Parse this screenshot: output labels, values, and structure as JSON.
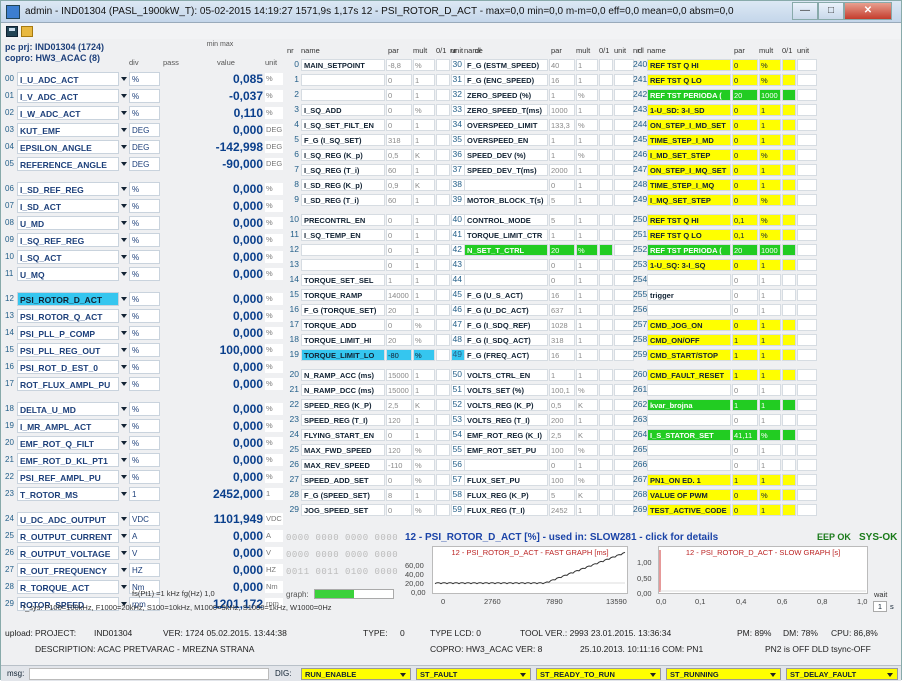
{
  "window": {
    "title": "admin - IND01304 (PASL_1900kW_T): 05-02-2015 14:19:27 1571,9s 1,17s 12 - PSI_ROTOR_D_ACT - max=0,0 min=0,0 m-m=0,0 eff=0,0 mean=0,0 absm=0,0",
    "min_glyph": "—",
    "max_glyph": "□",
    "close_glyph": "✕"
  },
  "left": {
    "header": {
      "pc_prj": "pc prj: IND01304 (1724)",
      "copro": "copro: HW3_ACAC (8)",
      "div": "div",
      "pass": "pass",
      "minmax": "min max",
      "value": "value",
      "unit": "unit"
    },
    "rows": [
      {
        "i": "00",
        "name": "I_U_ADC_ACT",
        "unit": "%",
        "value": "0,085",
        "vunit": "%"
      },
      {
        "i": "01",
        "name": "I_V_ADC_ACT",
        "unit": "%",
        "value": "-0,037",
        "vunit": "%"
      },
      {
        "i": "02",
        "name": "I_W_ADC_ACT",
        "unit": "%",
        "value": "0,110",
        "vunit": "%"
      },
      {
        "i": "03",
        "name": "KUT_EMF",
        "unit": "DEG",
        "value": "0,000",
        "vunit": "DEG"
      },
      {
        "i": "04",
        "name": "EPSILON_ANGLE",
        "unit": "DEG",
        "value": "-142,998",
        "vunit": "DEG"
      },
      {
        "i": "05",
        "name": "REFERENCE_ANGLE",
        "unit": "DEG",
        "value": "-90,000",
        "vunit": "DEG"
      },
      {
        "i": "06",
        "name": "I_SD_REF_REG",
        "unit": "%",
        "value": "0,000",
        "vunit": "%"
      },
      {
        "i": "07",
        "name": "I_SD_ACT",
        "unit": "%",
        "value": "0,000",
        "vunit": "%"
      },
      {
        "i": "08",
        "name": "U_MD",
        "unit": "%",
        "value": "0,000",
        "vunit": "%"
      },
      {
        "i": "09",
        "name": "I_SQ_REF_REG",
        "unit": "%",
        "value": "0,000",
        "vunit": "%"
      },
      {
        "i": "10",
        "name": "I_SQ_ACT",
        "unit": "%",
        "value": "0,000",
        "vunit": "%"
      },
      {
        "i": "11",
        "name": "U_MQ",
        "unit": "%",
        "value": "0,000",
        "vunit": "%"
      },
      {
        "i": "12",
        "name": "PSI_ROTOR_D_ACT",
        "unit": "%",
        "value": "0,000",
        "vunit": "%"
      },
      {
        "i": "13",
        "name": "PSI_ROTOR_Q_ACT",
        "unit": "%",
        "value": "0,000",
        "vunit": "%"
      },
      {
        "i": "14",
        "name": "PSI_PLL_P_COMP",
        "unit": "%",
        "value": "0,000",
        "vunit": "%"
      },
      {
        "i": "15",
        "name": "PSI_PLL_REG_OUT",
        "unit": "%",
        "value": "100,000",
        "vunit": "%"
      },
      {
        "i": "16",
        "name": "PSI_ROT_D_EST_0",
        "unit": "%",
        "value": "0,000",
        "vunit": "%"
      },
      {
        "i": "17",
        "name": "ROT_FLUX_AMPL_PU",
        "unit": "%",
        "value": "0,000",
        "vunit": "%"
      },
      {
        "i": "18",
        "name": "DELTA_U_MD",
        "unit": "%",
        "value": "0,000",
        "vunit": "%"
      },
      {
        "i": "19",
        "name": "I_MR_AMPL_ACT",
        "unit": "%",
        "value": "0,000",
        "vunit": "%"
      },
      {
        "i": "20",
        "name": "EMF_ROT_Q_FILT",
        "unit": "%",
        "value": "0,000",
        "vunit": "%"
      },
      {
        "i": "21",
        "name": "EMF_ROT_D_KL_PT1",
        "unit": "%",
        "value": "0,000",
        "vunit": "%"
      },
      {
        "i": "22",
        "name": "PSI_REF_AMPL_PU",
        "unit": "%",
        "value": "0,000",
        "vunit": "%"
      },
      {
        "i": "23",
        "name": "T_ROTOR_MS",
        "unit": "1",
        "value": "2452,000",
        "vunit": "1"
      },
      {
        "i": "24",
        "name": "U_DC_ADC_OUTPUT",
        "unit": "VDC",
        "value": "1101,949",
        "vunit": "VDC"
      },
      {
        "i": "25",
        "name": "R_OUTPUT_CURRENT",
        "unit": "A",
        "value": "0,000",
        "vunit": "A"
      },
      {
        "i": "26",
        "name": "R_OUTPUT_VOLTAGE",
        "unit": "V",
        "value": "0,000",
        "vunit": "V"
      },
      {
        "i": "27",
        "name": "R_OUT_FREQUENCY",
        "unit": "HZ",
        "value": "0,000",
        "vunit": "HZ"
      },
      {
        "i": "28",
        "name": "R_TORQUE_ACT",
        "unit": "Nm",
        "value": "0,000",
        "vunit": "Nm"
      },
      {
        "i": "29",
        "name": "ROTOR_SPEED",
        "unit": "rpm",
        "value": "1201,172",
        "vunit": "rpm"
      }
    ],
    "fs_line": "fs(Pt1) =1 kHz   fg(Hz)  1,0",
    "fsys_line": "f_sys: F100=100kHz, F1000=20kHz, S100=10kHz, M1000=5kHz, S1000=1kHz, W1000=0Hz"
  },
  "grid_headers": {
    "nr": "nr",
    "name": "name",
    "par": "par",
    "mult": "mult",
    "b01": "0/1",
    "unit": "unit",
    "dl": "dl"
  },
  "col1": [
    {
      "n": "0",
      "name": "MAIN_SETPOINT",
      "par": "-8,8",
      "mult": "%"
    },
    {
      "n": "1",
      "name": "",
      "par": "0",
      "mult": "1"
    },
    {
      "n": "2",
      "name": "",
      "par": "0",
      "mult": "1"
    },
    {
      "n": "3",
      "name": "I_SQ_ADD",
      "par": "0",
      "mult": "%"
    },
    {
      "n": "4",
      "name": "I_SQ_SET_FILT_EN",
      "par": "0",
      "mult": "1"
    },
    {
      "n": "5",
      "name": "F_G (I_SQ_SET)",
      "par": "318",
      "mult": "1"
    },
    {
      "n": "6",
      "name": "I_SQ_REG (K_p)",
      "par": "0,5",
      "mult": "K"
    },
    {
      "n": "7",
      "name": "I_SQ_REG (T_i)",
      "par": "60",
      "mult": "1"
    },
    {
      "n": "8",
      "name": "I_SD_REG (K_p)",
      "par": "0,9",
      "mult": "K"
    },
    {
      "n": "9",
      "name": "I_SD_REG (T_i)",
      "par": "60",
      "mult": "1"
    },
    {
      "n": "10",
      "name": "PRECONTRL_EN",
      "par": "0",
      "mult": "1"
    },
    {
      "n": "11",
      "name": "I_SQ_TEMP_EN",
      "par": "0",
      "mult": "1"
    },
    {
      "n": "12",
      "name": "",
      "par": "0",
      "mult": "1"
    },
    {
      "n": "13",
      "name": "",
      "par": "0",
      "mult": "1"
    },
    {
      "n": "14",
      "name": "TORQUE_SET_SEL",
      "par": "1",
      "mult": "1"
    },
    {
      "n": "15",
      "name": "TORQUE_RAMP",
      "par": "14000",
      "mult": "1"
    },
    {
      "n": "16",
      "name": "F_G (TORQUE_SET)",
      "par": "20",
      "mult": "1"
    },
    {
      "n": "17",
      "name": "TORQUE_ADD",
      "par": "0",
      "mult": "%"
    },
    {
      "n": "18",
      "name": "TORQUE_LIMIT_HI",
      "par": "20",
      "mult": "%"
    },
    {
      "n": "19",
      "name": "TORQUE_LIMIT_LO",
      "par": "-80",
      "mult": "%",
      "cls": "cya"
    },
    {
      "n": "20",
      "name": "N_RAMP_ACC (ms)",
      "par": "15000",
      "mult": "1"
    },
    {
      "n": "21",
      "name": "N_RAMP_DCC (ms)",
      "par": "15000",
      "mult": "1"
    },
    {
      "n": "22",
      "name": "SPEED_REG (K_P)",
      "par": "2,5",
      "mult": "K"
    },
    {
      "n": "23",
      "name": "SPEED_REG (T_I)",
      "par": "120",
      "mult": "1"
    },
    {
      "n": "24",
      "name": "FLYING_START_EN",
      "par": "0",
      "mult": "1"
    },
    {
      "n": "25",
      "name": "MAX_FWD_SPEED",
      "par": "120",
      "mult": "%"
    },
    {
      "n": "26",
      "name": "MAX_REV_SPEED",
      "par": "-110",
      "mult": "%"
    },
    {
      "n": "27",
      "name": "SPEED_ADD_SET",
      "par": "0",
      "mult": "%"
    },
    {
      "n": "28",
      "name": "F_G (SPEED_SET)",
      "par": "8",
      "mult": "1"
    },
    {
      "n": "29",
      "name": "JOG_SPEED_SET",
      "par": "0",
      "mult": "%"
    }
  ],
  "col2": [
    {
      "n": "30",
      "name": "F_G (ESTM_SPEED)",
      "par": "40",
      "mult": "1"
    },
    {
      "n": "31",
      "name": "F_G (ENC_SPEED)",
      "par": "16",
      "mult": "1"
    },
    {
      "n": "32",
      "name": "ZERO_SPEED (%)",
      "par": "1",
      "mult": "%"
    },
    {
      "n": "33",
      "name": "ZERO_SPEED_T(ms)",
      "par": "1000",
      "mult": "1"
    },
    {
      "n": "34",
      "name": "OVERSPEED_LIMIT",
      "par": "133,3",
      "mult": "%"
    },
    {
      "n": "35",
      "name": "OVERSPEED_EN",
      "par": "1",
      "mult": "1"
    },
    {
      "n": "36",
      "name": "SPEED_DEV (%)",
      "par": "1",
      "mult": "%"
    },
    {
      "n": "37",
      "name": "SPEED_DEV_T(ms)",
      "par": "2000",
      "mult": "1"
    },
    {
      "n": "38",
      "name": "",
      "par": "0",
      "mult": "1"
    },
    {
      "n": "39",
      "name": "MOTOR_BLOCK_T(s)",
      "par": "5",
      "mult": "1"
    },
    {
      "n": "40",
      "name": "CONTROL_MODE",
      "par": "5",
      "mult": "1"
    },
    {
      "n": "41",
      "name": "TORQUE_LIMIT_CTR",
      "par": "1",
      "mult": "1"
    },
    {
      "n": "42",
      "name": "N_SET_T_CTRL",
      "par": "20",
      "mult": "%",
      "cls": "grn"
    },
    {
      "n": "43",
      "name": "",
      "par": "0",
      "mult": "1"
    },
    {
      "n": "44",
      "name": "",
      "par": "0",
      "mult": "1"
    },
    {
      "n": "45",
      "name": "F_G (U_S_ACT)",
      "par": "16",
      "mult": "1"
    },
    {
      "n": "46",
      "name": "F_G (U_DC_ACT)",
      "par": "637",
      "mult": "1"
    },
    {
      "n": "47",
      "name": "F_G (I_SDQ_REF)",
      "par": "1028",
      "mult": "1"
    },
    {
      "n": "48",
      "name": "F_G (I_SDQ_ACT)",
      "par": "318",
      "mult": "1"
    },
    {
      "n": "49",
      "name": "F_G (FREQ_ACT)",
      "par": "16",
      "mult": "1"
    },
    {
      "n": "50",
      "name": "VOLTS_CTRL_EN",
      "par": "1",
      "mult": "1"
    },
    {
      "n": "51",
      "name": "VOLTS_SET (%)",
      "par": "100,1",
      "mult": "%"
    },
    {
      "n": "52",
      "name": "VOLTS_REG (K_P)",
      "par": "0,5",
      "mult": "K"
    },
    {
      "n": "53",
      "name": "VOLTS_REG (T_I)",
      "par": "200",
      "mult": "1"
    },
    {
      "n": "54",
      "name": "EMF_ROT_REG (K_I)",
      "par": "2,5",
      "mult": "K"
    },
    {
      "n": "55",
      "name": "EMF_ROT_SET_PU",
      "par": "100",
      "mult": "%"
    },
    {
      "n": "56",
      "name": "",
      "par": "0",
      "mult": "1"
    },
    {
      "n": "57",
      "name": "FLUX_SET_PU",
      "par": "100",
      "mult": "%"
    },
    {
      "n": "58",
      "name": "FLUX_REG (K_P)",
      "par": "5",
      "mult": "K"
    },
    {
      "n": "59",
      "name": "FLUX_REG (T_I)",
      "par": "2452",
      "mult": "1"
    }
  ],
  "col3": [
    {
      "n": "240",
      "name": "REF TST Q HI",
      "par": "0",
      "mult": "%",
      "cls": "yel"
    },
    {
      "n": "241",
      "name": "REF TST Q LO",
      "par": "0",
      "mult": "%",
      "cls": "yel"
    },
    {
      "n": "242",
      "name": "REF TST PERIODA (",
      "par": "20",
      "mult": "1000",
      "cls": "grn"
    },
    {
      "n": "243",
      "name": "1-U_SD: 3-I_SD",
      "par": "0",
      "mult": "1",
      "cls": "yel"
    },
    {
      "n": "244",
      "name": "ON_STEP_I_MD_SET",
      "par": "0",
      "mult": "1",
      "cls": "yel"
    },
    {
      "n": "245",
      "name": "TIME_STEP_I_MD",
      "par": "0",
      "mult": "1",
      "cls": "yel"
    },
    {
      "n": "246",
      "name": "I_MD_SET_STEP",
      "par": "0",
      "mult": "%",
      "cls": "yel"
    },
    {
      "n": "247",
      "name": "ON_STEP_I_MQ_SET",
      "par": "0",
      "mult": "1",
      "cls": "yel"
    },
    {
      "n": "248",
      "name": "TIME_STEP_I_MQ",
      "par": "0",
      "mult": "1",
      "cls": "yel"
    },
    {
      "n": "249",
      "name": "I_MQ_SET_STEP",
      "par": "0",
      "mult": "%",
      "cls": "yel"
    },
    {
      "n": "250",
      "name": "REF TST Q HI",
      "par": "0,1",
      "mult": "%",
      "cls": "yel"
    },
    {
      "n": "251",
      "name": "REF TST Q LO",
      "par": "0,1",
      "mult": "%",
      "cls": "yel"
    },
    {
      "n": "252",
      "name": "REF TST PERIODA (",
      "par": "20",
      "mult": "1000",
      "cls": "grn"
    },
    {
      "n": "253",
      "name": "1-U_SQ: 3-I_SQ",
      "par": "0",
      "mult": "1",
      "cls": "yel"
    },
    {
      "n": "254",
      "name": "",
      "par": "0",
      "mult": "1"
    },
    {
      "n": "255",
      "name": "trigger",
      "par": "0",
      "mult": "1"
    },
    {
      "n": "256",
      "name": "",
      "par": "0",
      "mult": "1"
    },
    {
      "n": "257",
      "name": "CMD_JOG_ON",
      "par": "0",
      "mult": "1",
      "cls": "yel"
    },
    {
      "n": "258",
      "name": "CMD_ON/OFF",
      "par": "1",
      "mult": "1",
      "cls": "yel"
    },
    {
      "n": "259",
      "name": "CMD_START/STOP",
      "par": "1",
      "mult": "1",
      "cls": "yel"
    },
    {
      "n": "260",
      "name": "CMD_FAULT_RESET",
      "par": "1",
      "mult": "1",
      "cls": "yel"
    },
    {
      "n": "261",
      "name": "",
      "par": "0",
      "mult": "1"
    },
    {
      "n": "262",
      "name": "kvar_brojna",
      "par": "1",
      "mult": "1",
      "cls": "grn"
    },
    {
      "n": "263",
      "name": "",
      "par": "0",
      "mult": "1"
    },
    {
      "n": "264",
      "name": "I_S_STATOR_SET",
      "par": "41,11",
      "mult": "%",
      "cls": "grn"
    },
    {
      "n": "265",
      "name": "",
      "par": "0",
      "mult": "1"
    },
    {
      "n": "266",
      "name": "",
      "par": "0",
      "mult": "1"
    },
    {
      "n": "267",
      "name": "PN1_ON ED. 1",
      "par": "1",
      "mult": "1",
      "cls": "yel"
    },
    {
      "n": "268",
      "name": "VALUE OF PWM",
      "par": "0",
      "mult": "%",
      "cls": "yel"
    },
    {
      "n": "269",
      "name": "TEST_ACTIVE_CODE",
      "par": "0",
      "mult": "1",
      "cls": "yel"
    }
  ],
  "bins": [
    "0000 0000 0000 0000",
    "0000 0000 0000 0000",
    "0011 0011 0100 0000"
  ],
  "graph_label": "graph:",
  "graph_progress": 0.5,
  "detail": {
    "title": "12 - PSI_ROTOR_D_ACT [%] - used in: SLOW281 - click for details",
    "eep": "EEP OK",
    "sys": "SYS-OK"
  },
  "fast_graph": {
    "caption": "12 - PSI_ROTOR_D_ACT - FAST GRAPH [ms]",
    "yticks": [
      "60,00",
      "40,00",
      "20,00",
      "0,00"
    ],
    "xticks": [
      "0",
      "2760",
      "7890",
      "13590"
    ]
  },
  "slow_graph": {
    "caption": "12 - PSI_ROTOR_D_ACT - SLOW GRAPH [s]",
    "yticks": [
      "1,00",
      "0,50",
      "0,00"
    ],
    "xticks": [
      "0,0",
      "0,1",
      "0,4",
      "0,6",
      "0,8",
      "1,0"
    ],
    "wait": "wait",
    "wait_val": "1",
    "wait_unit": "s"
  },
  "info": {
    "upload": "upload:",
    "project_lbl": "PROJECT:",
    "project": "IND01304",
    "ver": "VER: 1724  05.02.2015. 13:44:38",
    "type_lbl": "TYPE:",
    "type": "0",
    "typelcd": "TYPE LCD: 0",
    "toolver": "TOOL VER.:  2993  23.01.2015. 13:36:34",
    "pm": "PM: 89%",
    "dm": "DM: 78%",
    "cpu": "CPU: 86,8%",
    "desc": "DESCRIPTION:  ACAC PRETVARAC - MREZNA STRANA",
    "copro": "COPRO:  HW3_ACAC  VER: 8",
    "date": "25.10.2013. 10:11:16  COM: PN1",
    "pn2": "PN2 is OFF  DLD  tsync-OFF"
  },
  "status": {
    "msg": "msg:",
    "dig": "DIG:",
    "fields": [
      "RUN_ENABLE",
      "ST_FAULT",
      "ST_READY_TO_RUN",
      "ST_RUNNING",
      "ST_DELAY_FAULT"
    ]
  }
}
